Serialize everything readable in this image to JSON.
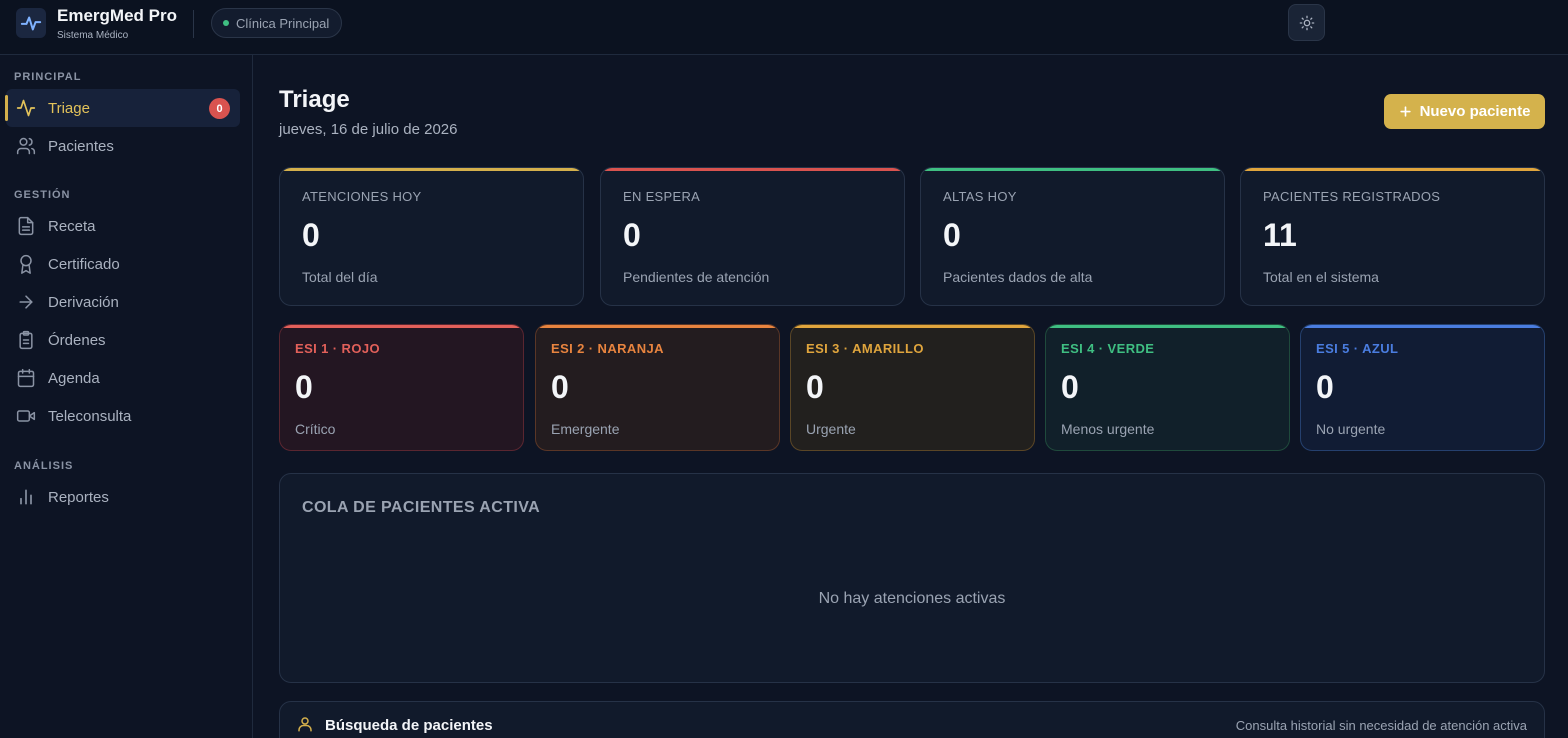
{
  "header": {
    "app_title": "EmergMed Pro",
    "app_subtitle": "Sistema Médico",
    "clinic": "Clínica Principal"
  },
  "sidebar": {
    "sections": [
      {
        "label": "PRINCIPAL"
      },
      {
        "label": "GESTIÓN"
      },
      {
        "label": "ANÁLISIS"
      }
    ],
    "items": [
      {
        "label": "Triage",
        "icon": "activity-icon",
        "badge": "0",
        "active": true
      },
      {
        "label": "Pacientes",
        "icon": "users-icon"
      },
      {
        "label": "Receta",
        "icon": "document-icon"
      },
      {
        "label": "Certificado",
        "icon": "award-icon"
      },
      {
        "label": "Derivación",
        "icon": "arrow-right-icon"
      },
      {
        "label": "Órdenes",
        "icon": "clipboard-icon"
      },
      {
        "label": "Agenda",
        "icon": "calendar-icon"
      },
      {
        "label": "Teleconsulta",
        "icon": "video-icon"
      },
      {
        "label": "Reportes",
        "icon": "bar-chart-icon"
      }
    ]
  },
  "main": {
    "title": "Triage",
    "date": "jueves, 16 de julio de 2026",
    "new_patient_label": "Nuevo paciente",
    "stats": [
      {
        "label": "ATENCIONES HOY",
        "value": "0",
        "desc": "Total del día",
        "color": "#d4b04c"
      },
      {
        "label": "EN ESPERA",
        "value": "0",
        "desc": "Pendientes de atención",
        "color": "#d9534f"
      },
      {
        "label": "ALTAS HOY",
        "value": "0",
        "desc": "Pacientes dados de alta",
        "color": "#3fbf82"
      },
      {
        "label": "PACIENTES REGISTRADOS",
        "value": "11",
        "desc": "Total en el sistema",
        "color": "#e0a53d"
      }
    ],
    "esi": [
      {
        "label": "ESI 1 · ROJO",
        "value": "0",
        "desc": "Crítico",
        "color": "#e2605a",
        "bg": "#231622",
        "border": "#5a2630"
      },
      {
        "label": "ESI 2 · NARANJA",
        "value": "0",
        "desc": "Emergente",
        "color": "#e8843f",
        "bg": "#231c1f",
        "border": "#5a3626"
      },
      {
        "label": "ESI 3 · AMARILLO",
        "value": "0",
        "desc": "Urgente",
        "color": "#e0a53d",
        "bg": "#22201e",
        "border": "#5a4626"
      },
      {
        "label": "ESI 4 · VERDE",
        "value": "0",
        "desc": "Menos urgente",
        "color": "#3fbf82",
        "bg": "#11202a",
        "border": "#1f4a3c"
      },
      {
        "label": "ESI 5 · AZUL",
        "value": "0",
        "desc": "No urgente",
        "color": "#4a7de0",
        "bg": "#111c34",
        "border": "#25406e"
      }
    ],
    "queue": {
      "title": "COLA DE PACIENTES ACTIVA",
      "empty": "No hay atenciones activas"
    },
    "search": {
      "title": "Búsqueda de pacientes",
      "subtitle": "Consulta historial sin necesidad de atención activa"
    }
  }
}
